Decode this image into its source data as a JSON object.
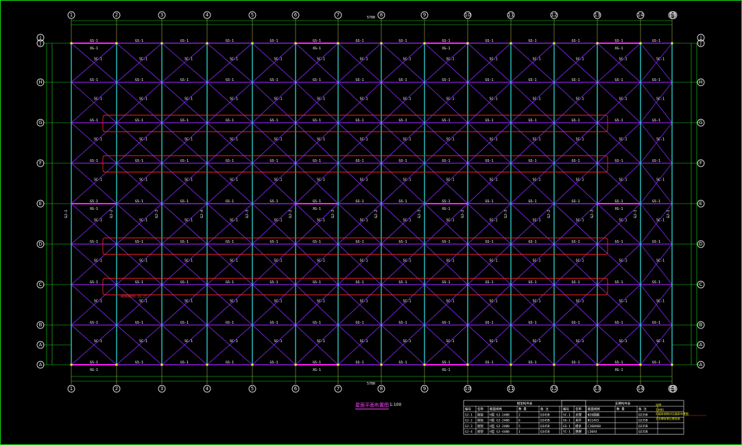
{
  "drawing": {
    "title": "屋面平面布置图",
    "scale": "1:100",
    "note_red": "WEB800X6 18.27"
  },
  "grid": {
    "columns": [
      "1",
      "2",
      "3",
      "4",
      "5",
      "6",
      "7",
      "8",
      "9",
      "10",
      "11",
      "12",
      "13",
      "14",
      "15",
      "16"
    ],
    "rows_left": [
      "A",
      "B",
      "C",
      "D",
      "E",
      "F",
      "G",
      "H",
      "J"
    ],
    "bottom_dim": "5700",
    "top_dim": "5700"
  },
  "members": {
    "purlin_label": "GS-1",
    "brace_label": "SC-1",
    "column_labels": [
      "GJ-1",
      "GJ-2",
      "GJ-3",
      "GJ-4",
      "GJ-3",
      "GJ-2",
      "GJ-3",
      "GJ-2",
      "GJ-3",
      "GJ-2",
      "GJ-3",
      "GJ-2",
      "GJ-3",
      "GJ-1"
    ],
    "tie_label": "XG-1"
  },
  "table1": {
    "title": "钢架构件表",
    "headers": [
      "编号",
      "名称",
      "截面规格",
      "数 量",
      "备 注"
    ],
    "rows": [
      [
        "GJ-1",
        "刚架",
        "H型 GJ-1400",
        "2",
        "Q345B"
      ],
      [
        "GJ-2",
        "刚架",
        "H型 GJ-2400",
        "6",
        "Q345B"
      ],
      [
        "GJ-3",
        "刚架",
        "H型 GJ-3400",
        "5",
        "Q345B"
      ],
      [
        "GJ-4",
        "刚架",
        "H型 GJ-4400",
        "1",
        "Q345B"
      ]
    ]
  },
  "table2": {
    "title": "支撑构件表",
    "headers": [
      "编号",
      "名称",
      "截面规格",
      "数 量",
      "备 注"
    ],
    "rows": [
      [
        "SC-1",
        "支撑",
        "Φ20圆钢",
        "",
        "Q235B"
      ],
      [
        "XG-1",
        "系杆",
        "Φ114X3",
        "",
        "Q235B"
      ],
      [
        "GS-1",
        "檩条",
        "C160X60",
        "",
        "Q235B"
      ],
      [
        "YC-1",
        "隅撑",
        "L50X4",
        "",
        "Q235B"
      ]
    ]
  },
  "notes": {
    "heading": "说明:",
    "lines": [
      "1.材料",
      "2.檩条规格详见檩条布置图",
      "3.支撑安装后需张紧"
    ]
  },
  "colors": {
    "frame": "#18e018",
    "purlin": "#8a1ee0",
    "column": "#2fd6d6",
    "brace": "#7a26e0",
    "magenta": "#ff22ff",
    "red": "#ff2020",
    "grid": "#cfcf60",
    "yellow": "#f0f020"
  }
}
